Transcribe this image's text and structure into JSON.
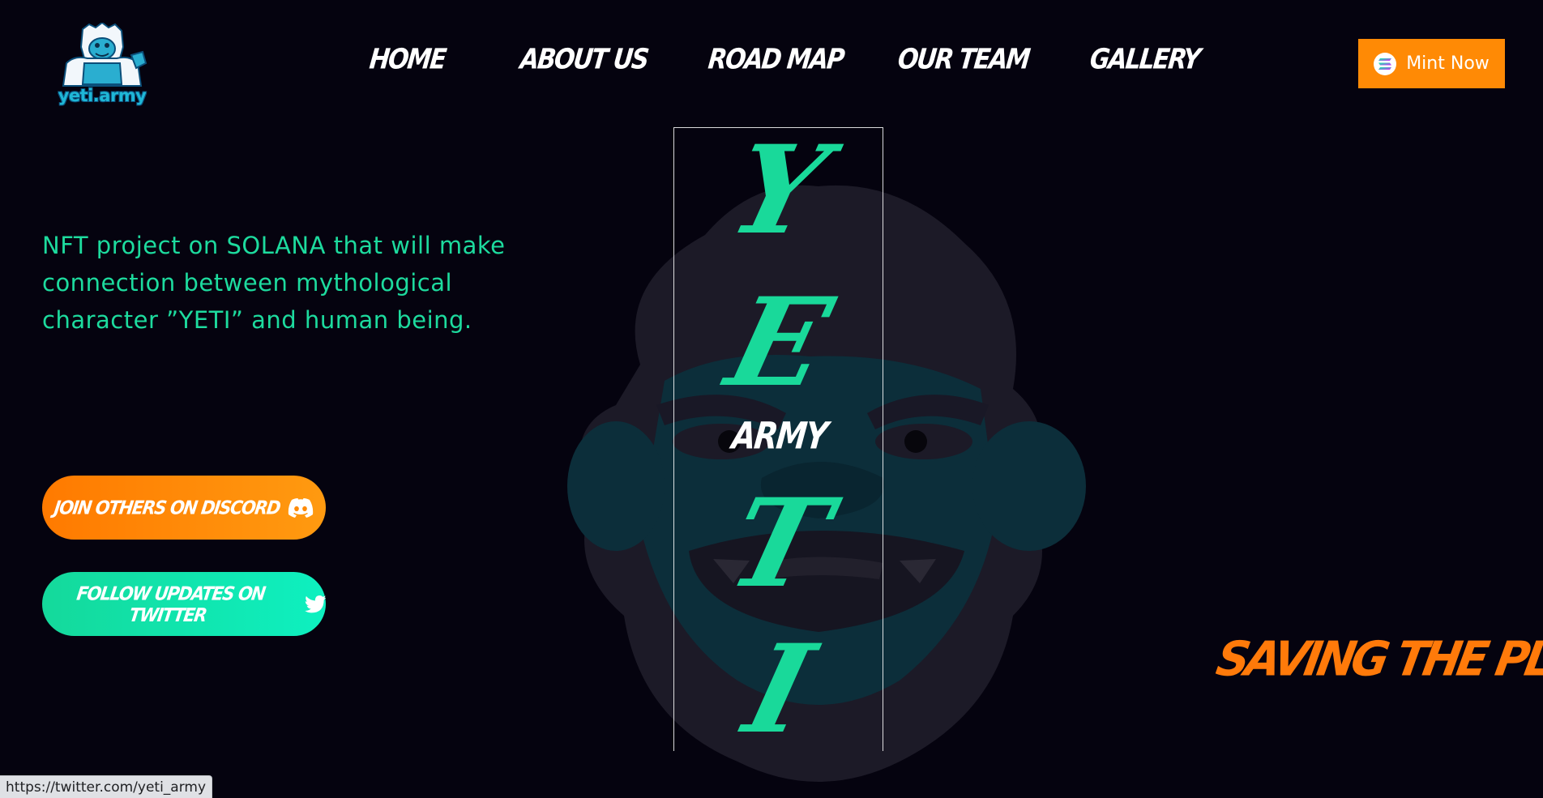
{
  "brand": {
    "logo_text": "yeti.army"
  },
  "nav": {
    "items": [
      "HOME",
      "ABOUT US",
      "ROAD MAP",
      "OUR TEAM",
      "GALLERY"
    ]
  },
  "mint": {
    "label": "Mint Now",
    "icon": "solana-icon"
  },
  "hero": {
    "title_letters": [
      "Y",
      "E",
      "T",
      "I"
    ],
    "title_sub": "ARMY",
    "description": "NFT project on SOLANA that will make connection between mythological character ”YETI” and human being.",
    "tagline": "SAVING THE PLANET"
  },
  "cta": {
    "discord_label": "JOIN OTHERS ON DISCORD",
    "discord_icon": "discord-icon",
    "twitter_label": "FOLLOW UPDATES ON TWITTER",
    "twitter_icon": "twitter-icon"
  },
  "status_bar": {
    "url": "https://twitter.com/yeti_army"
  },
  "colors": {
    "background": "#05030f",
    "accent_green": "#19d99a",
    "accent_orange": "#ff8a05",
    "logo_blue": "#1fb7d6"
  }
}
